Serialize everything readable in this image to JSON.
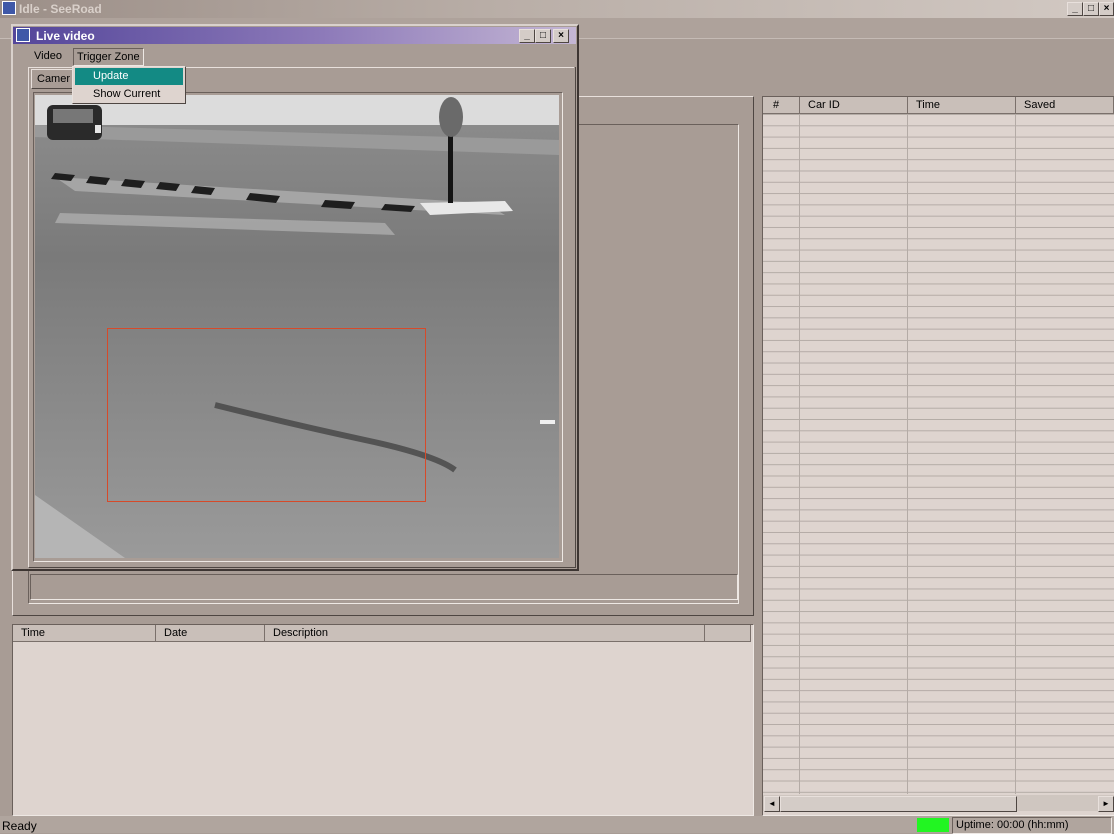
{
  "main_window": {
    "title": "Idle - SeeRoad",
    "caption_buttons": [
      "_",
      "□",
      "×"
    ]
  },
  "live_video": {
    "title": "Live video",
    "caption_buttons": [
      "_",
      "□",
      "×"
    ],
    "menu": [
      "Video",
      "Trigger Zone"
    ],
    "tab_label": "Camer",
    "dropdown_items": [
      "Update",
      "Show Current"
    ]
  },
  "events_table": {
    "columns": [
      "Time",
      "Date",
      "Description"
    ],
    "rows": []
  },
  "cars_table": {
    "columns": [
      "#",
      "Car ID",
      "Time",
      "Saved"
    ],
    "rows": []
  },
  "status": {
    "text": "Ready",
    "uptime": "Uptime: 00:00 (hh:mm)",
    "indicator_color": "#22f522"
  },
  "icons": {
    "app": "app-icon",
    "scroll_left": "◄",
    "scroll_right": "►"
  }
}
